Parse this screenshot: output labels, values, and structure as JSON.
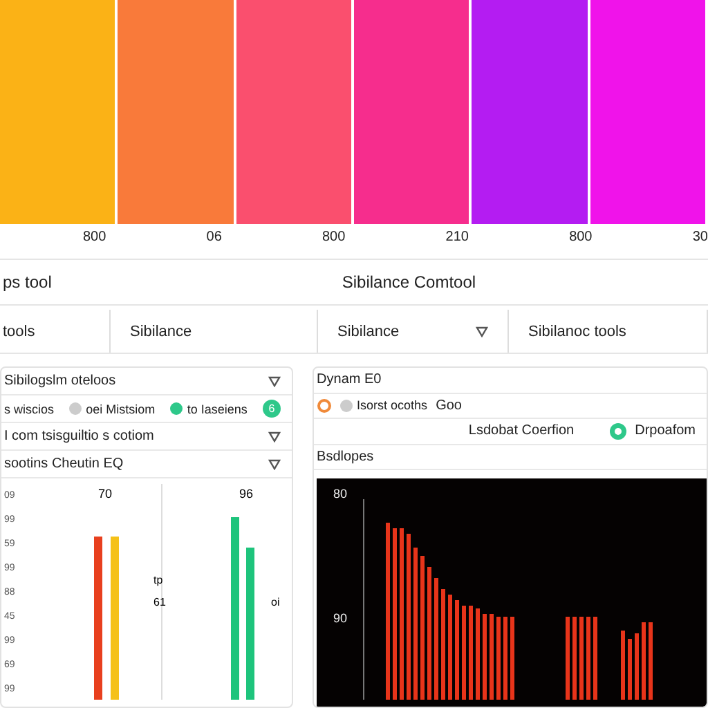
{
  "bands": [
    {
      "color": "#fbb216"
    },
    {
      "color": "#f97a3a"
    },
    {
      "color": "#fa4f6e"
    },
    {
      "color": "#f62d8d"
    },
    {
      "color": "#b41cf2"
    },
    {
      "color": "#f013ea"
    }
  ],
  "band_ticks": [
    "800",
    "06",
    "800",
    "210",
    "800",
    "30"
  ],
  "title_bar": {
    "left": "ps tool",
    "center": "Sibilance Comtool"
  },
  "tool_row": [
    {
      "label": "tools",
      "dropdown": false
    },
    {
      "label": "Sibilance",
      "dropdown": false
    },
    {
      "label": "Sibilance",
      "dropdown": true
    },
    {
      "label": "Sibilanoc tools",
      "dropdown": false
    }
  ],
  "left_panel": {
    "header": "Sibilogslm oteloos",
    "options": [
      {
        "label": "s wiscios",
        "kind": "text"
      },
      {
        "label": "oei Mistsiom",
        "kind": "dot",
        "on": false
      },
      {
        "label": "to Iaseiens",
        "kind": "dot",
        "on": true
      },
      {
        "label": "6",
        "kind": "badge"
      }
    ],
    "rows": [
      "I com tsisguiltio s cotiom",
      "sootins Cheutin EQ"
    ],
    "chart": {
      "column_labels": [
        "70",
        "96"
      ],
      "y_labels": [
        "09",
        "99",
        "59",
        "99",
        "88",
        "45",
        "99",
        "69",
        "99"
      ],
      "side_labels": [
        "tp",
        "61",
        "oi"
      ]
    }
  },
  "right_panel": {
    "header": "Dynam E0",
    "status": "Isorst ocoths",
    "status_value": "Goo",
    "mode_label": "Lsdobat Coerfion",
    "mode_value": "Drpoafom",
    "section": "Bsdlopes",
    "y_labels": [
      "80",
      "90"
    ]
  }
}
